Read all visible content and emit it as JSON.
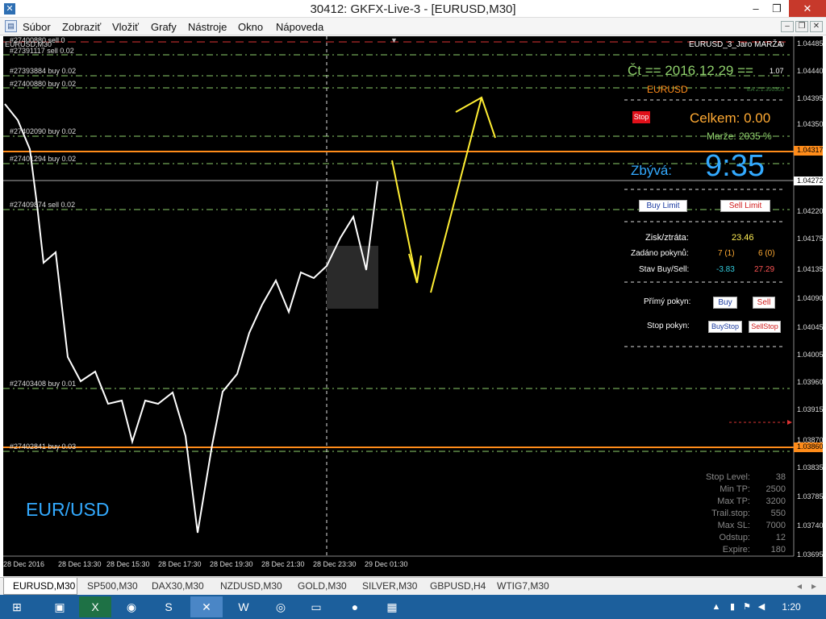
{
  "window": {
    "title": "30412: GKFX-Live-3 - [EURUSD,M30]",
    "min": "–",
    "restore": "❐",
    "close": "✕"
  },
  "menu": [
    "Súbor",
    "Zobraziť",
    "Vložiť",
    "Grafy",
    "Nástroje",
    "Okno",
    "Nápoveda"
  ],
  "chart": {
    "symbol_label": "EURUSD,M30",
    "watermark": "EUR/USD",
    "ea_name": "EURUSD_3_Jaro MARŽA",
    "ea_small": "EA 2.1.300303",
    "date_text": "Čt  ==  2016.12.29  ==",
    "leverage": "1.07",
    "pair": "EURUSD",
    "stop_button": "Stop",
    "celkem": "Celkem:  0.00",
    "marze": "Marže:  2035 %",
    "zbyva_label": "Zbývá:",
    "zbyva_time": "9:35",
    "buy_limit": "Buy Limit",
    "sell_limit": "Sell Limit",
    "zisk_label": "Zisk/ztráta:",
    "zisk_value": "23.46",
    "zadano_label": "Zadáno pokynů:",
    "zadano_buy": "7 (1)",
    "zadano_sell": "6 (0)",
    "stav_label": "Stav Buy/Sell:",
    "stav_buy": "-3.83",
    "stav_sell": "27.29",
    "primy_label": "Přímý pokyn:",
    "buy": "Buy",
    "sell": "Sell",
    "stop_label": "Stop pokyn:",
    "buystop": "BuyStop",
    "sellstop": "SellStop",
    "orders": [
      "#27400880 sell 0",
      "#27391117 sell 0.02",
      "#27393884 buy 0.02",
      "#27400880 buy 0.02",
      "#27402090 buy 0.02",
      "#27401294 buy 0.02",
      "#27409874 sell 0.02",
      "#27403408 buy 0.01",
      "#27402841 buy 0.03"
    ],
    "price_axis": [
      "1.04485",
      "1.04440",
      "1.04395",
      "1.04350",
      "1.04317",
      "1.04272",
      "1.04220",
      "1.04175",
      "1.04135",
      "1.04090",
      "1.04045",
      "1.04005",
      "1.03960",
      "1.03915",
      "1.03870",
      "1.03860",
      "1.03835",
      "1.03785",
      "1.03740",
      "1.03695"
    ],
    "time_axis": [
      "28 Dec 2016",
      "28 Dec 13:30",
      "28 Dec 15:30",
      "28 Dec 17:30",
      "28 Dec 19:30",
      "28 Dec 21:30",
      "28 Dec 23:30",
      "29 Dec 01:30"
    ],
    "stats": [
      {
        "label": "Stop Level:",
        "value": "38"
      },
      {
        "label": "Min TP:",
        "value": "2500"
      },
      {
        "label": "Max TP:",
        "value": "3200"
      },
      {
        "label": "Trail.stop:",
        "value": "550"
      },
      {
        "label": "Max SL:",
        "value": "7000"
      },
      {
        "label": "Odstup:",
        "value": "12"
      },
      {
        "label": "Expire:",
        "value": "180"
      }
    ],
    "colors": {
      "price_line": "#ffffff",
      "arrows": "#ffee33",
      "orange_level": "#ff8c1a",
      "grid_green": "#8ecf6b",
      "zbyva": "#33aaff",
      "celkem": "#ffaa33"
    }
  },
  "tabs": [
    "EURUSD,M30",
    "SP500,M30",
    "DAX30,M30",
    "NZDUSD,M30",
    "GOLD,M30",
    "SILVER,M30",
    "GBPUSD,H4",
    "WTIG7,M30"
  ],
  "taskbar": {
    "time": "1:20",
    "icons": [
      "start-icon",
      "explorer-icon",
      "excel-icon",
      "metatrader-icon",
      "skype-icon",
      "mt4-active-icon",
      "word-icon",
      "chrome-icon",
      "folder-icon",
      "paint-icon",
      "app-icon"
    ]
  }
}
